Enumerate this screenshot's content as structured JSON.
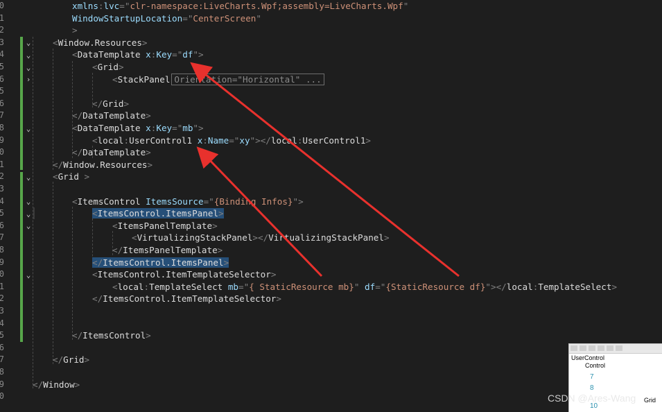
{
  "line_numbers": [
    "0",
    "1",
    "2",
    "3",
    "4",
    "5",
    "6",
    "5",
    "6",
    "7",
    "8",
    "9",
    "0",
    "1",
    "2",
    "3",
    "4",
    "5",
    "6",
    "7",
    "8",
    "9",
    "0",
    "1",
    "2",
    "3",
    "4",
    "5",
    "6",
    "7",
    "8",
    "9",
    "0"
  ],
  "code_lines": [
    [
      [
        "attr",
        "xmlns"
      ],
      [
        "delim",
        ":"
      ],
      [
        "attr",
        "lvc"
      ],
      [
        "delim",
        "=\""
      ],
      [
        "str",
        "clr-namespace:LiveCharts.Wpf;assembly=LiveCharts.Wpf"
      ],
      [
        "delim",
        "\""
      ]
    ],
    [
      [
        "attr",
        "WindowStartupLocation"
      ],
      [
        "delim",
        "=\""
      ],
      [
        "str",
        "CenterScreen"
      ],
      [
        "delim",
        "\""
      ]
    ],
    [
      [
        "delim",
        ">"
      ]
    ],
    [
      [
        "delim",
        "<"
      ],
      [
        "el",
        "Window.Resources"
      ],
      [
        "delim",
        ">"
      ]
    ],
    [
      [
        "delim",
        "<"
      ],
      [
        "el",
        "DataTemplate "
      ],
      [
        "attr",
        "x"
      ],
      [
        "delim",
        ":"
      ],
      [
        "attr",
        "Key"
      ],
      [
        "delim",
        "=\""
      ],
      [
        "attr",
        "df"
      ],
      [
        "delim",
        "\">"
      ]
    ],
    [
      [
        "delim",
        "<"
      ],
      [
        "el",
        "Grid"
      ],
      [
        "delim",
        ">"
      ]
    ],
    [
      [
        "delim",
        "<"
      ],
      [
        "el",
        "StackPanel"
      ]
    ],
    [],
    [
      [
        "delim",
        "</"
      ],
      [
        "el",
        "Grid"
      ],
      [
        "delim",
        ">"
      ]
    ],
    [
      [
        "delim",
        "</"
      ],
      [
        "el",
        "DataTemplate"
      ],
      [
        "delim",
        ">"
      ]
    ],
    [
      [
        "delim",
        "<"
      ],
      [
        "el",
        "DataTemplate "
      ],
      [
        "attr",
        "x"
      ],
      [
        "delim",
        ":"
      ],
      [
        "attr",
        "Key"
      ],
      [
        "delim",
        "=\""
      ],
      [
        "attr",
        "mb"
      ],
      [
        "delim",
        "\">"
      ]
    ],
    [
      [
        "delim",
        "<"
      ],
      [
        "el",
        "local"
      ],
      [
        "delim",
        ":"
      ],
      [
        "el",
        "UserControl1 "
      ],
      [
        "attr",
        "x"
      ],
      [
        "delim",
        ":"
      ],
      [
        "attr",
        "Name"
      ],
      [
        "delim",
        "=\""
      ],
      [
        "attr",
        "xy"
      ],
      [
        "delim",
        "\"></"
      ],
      [
        "el",
        "local"
      ],
      [
        "delim",
        ":"
      ],
      [
        "el",
        "UserControl1"
      ],
      [
        "delim",
        ">"
      ]
    ],
    [
      [
        "delim",
        "</"
      ],
      [
        "el",
        "DataTemplate"
      ],
      [
        "delim",
        ">"
      ]
    ],
    [
      [
        "delim",
        "</"
      ],
      [
        "el",
        "Window.Resources"
      ],
      [
        "delim",
        ">"
      ]
    ],
    [
      [
        "delim",
        "<"
      ],
      [
        "el",
        "Grid "
      ],
      [
        "delim",
        ">"
      ]
    ],
    [],
    [
      [
        "delim",
        "<"
      ],
      [
        "el",
        "ItemsControl "
      ],
      [
        "attr",
        "ItemsSource"
      ],
      [
        "delim",
        "=\""
      ],
      [
        "str",
        "{Binding Infos}"
      ],
      [
        "delim",
        "\">"
      ]
    ],
    [
      [
        "delim",
        "<"
      ],
      [
        "el",
        "ItemsControl.ItemsPanel"
      ],
      [
        "delim",
        ">"
      ]
    ],
    [
      [
        "delim",
        "<"
      ],
      [
        "el",
        "ItemsPanelTemplate"
      ],
      [
        "delim",
        ">"
      ]
    ],
    [
      [
        "delim",
        "<"
      ],
      [
        "el",
        "VirtualizingStackPanel"
      ],
      [
        "delim",
        "></"
      ],
      [
        "el",
        "VirtualizingStackPanel"
      ],
      [
        "delim",
        ">"
      ]
    ],
    [
      [
        "delim",
        "</"
      ],
      [
        "el",
        "ItemsPanelTemplate"
      ],
      [
        "delim",
        ">"
      ]
    ],
    [
      [
        "delim",
        "</"
      ],
      [
        "el",
        "ItemsControl.ItemsPanel"
      ],
      [
        "delim",
        ">"
      ]
    ],
    [
      [
        "delim",
        "<"
      ],
      [
        "el",
        "ItemsControl.ItemTemplateSelector"
      ],
      [
        "delim",
        ">"
      ]
    ],
    [
      [
        "delim",
        "<"
      ],
      [
        "el",
        "local"
      ],
      [
        "delim",
        ":"
      ],
      [
        "el",
        "TemplateSelect "
      ],
      [
        "attr",
        "mb"
      ],
      [
        "delim",
        "=\""
      ],
      [
        "str",
        "{ StaticResource mb}"
      ],
      [
        "delim",
        "\" "
      ],
      [
        "attr",
        "df"
      ],
      [
        "delim",
        "=\""
      ],
      [
        "str",
        "{StaticResource df}"
      ],
      [
        "delim",
        "\"></"
      ],
      [
        "el",
        "local"
      ],
      [
        "delim",
        ":"
      ],
      [
        "el",
        "TemplateSelect"
      ],
      [
        "delim",
        ">"
      ]
    ],
    [
      [
        "delim",
        "</"
      ],
      [
        "el",
        "ItemsControl.ItemTemplateSelector"
      ],
      [
        "delim",
        ">"
      ]
    ],
    [],
    [],
    [
      [
        "delim",
        "</"
      ],
      [
        "el",
        "ItemsControl"
      ],
      [
        "delim",
        ">"
      ]
    ],
    [],
    [
      [
        "delim",
        "</"
      ],
      [
        "el",
        "Grid"
      ],
      [
        "delim",
        ">"
      ]
    ],
    [],
    [
      [
        "delim",
        "</"
      ],
      [
        "el",
        "Window"
      ],
      [
        "delim",
        ">"
      ]
    ],
    []
  ],
  "collapsed_hint": "Orientation=\"Horizontal\" ...",
  "thumbnail": {
    "labels": [
      "UserControl",
      "Control"
    ],
    "line_numbers": [
      "7",
      "8",
      "10"
    ],
    "trailing_text": "Grid"
  },
  "watermark": "CSDN @Ares-Wang",
  "colors": {
    "background": "#1e1e1e",
    "attribute": "#9cdcfe",
    "string": "#ce9178",
    "delimiter": "#808080",
    "arrow": "#e8312d",
    "selection": "#264f78",
    "change_bar": "#57a64a"
  }
}
